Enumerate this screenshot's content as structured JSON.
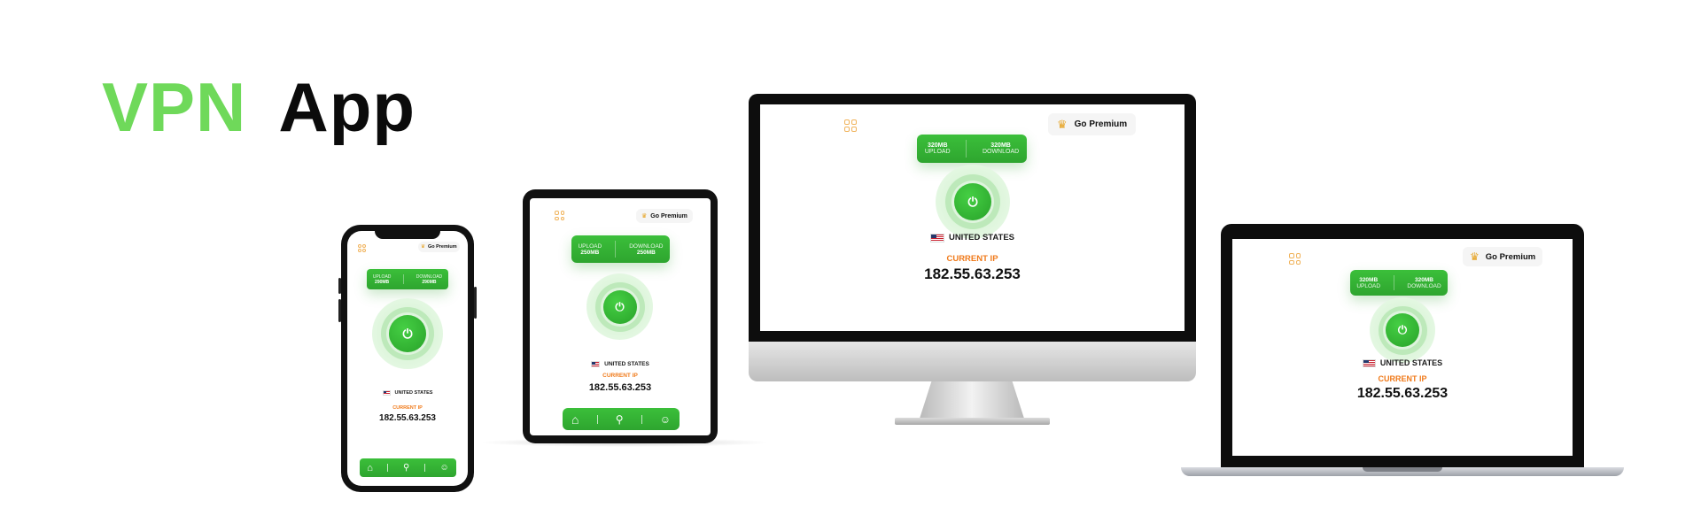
{
  "hero": {
    "accent": "VPN",
    "main": "App"
  },
  "app": {
    "premium_label": "Go Premium",
    "upload_label": "UPLOAD",
    "download_label": "DOWNLOAD",
    "upload_value_phone": "290MB",
    "download_value_phone": "290MB",
    "upload_value_tablet": "250MB",
    "download_value_tablet": "250MB",
    "upload_value_desktop": "320MB",
    "download_value_desktop": "320MB",
    "country": "UNITED STATES",
    "ip_label": "CURRENT IP",
    "ip_value": "182.55.63.253"
  },
  "icons": {
    "menu": "grid-icon",
    "crown": "crown-icon",
    "power": "power-icon",
    "home": "home-icon",
    "location": "location-pin-icon",
    "profile": "user-icon",
    "flag": "us-flag-icon"
  },
  "colors": {
    "accent_green": "#6fd95a",
    "app_green": "#2ea52f",
    "ip_label_orange": "#f07a1a",
    "menu_orange": "#f0b35b",
    "crown_gold": "#e6a323"
  }
}
